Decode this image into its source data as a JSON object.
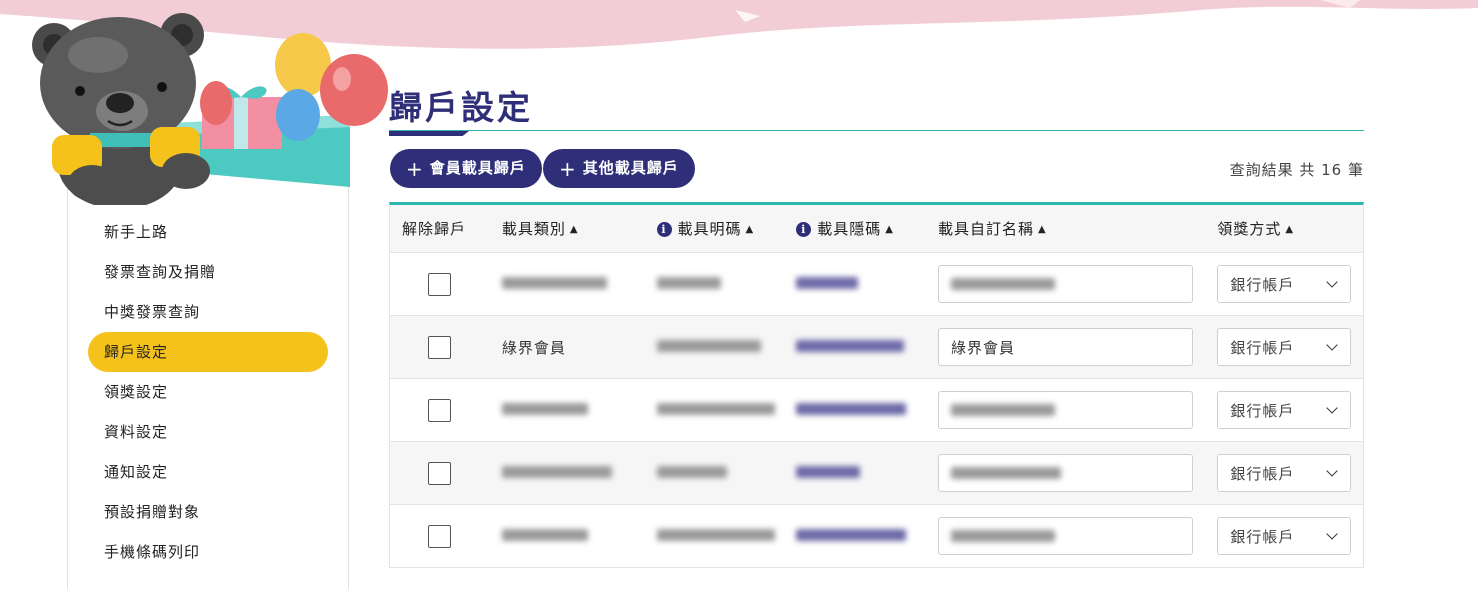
{
  "page_title": "歸戶設定",
  "sidebar": {
    "items": [
      {
        "label": "新手上路",
        "active": false
      },
      {
        "label": "發票查詢及捐贈",
        "active": false
      },
      {
        "label": "中獎發票查詢",
        "active": false
      },
      {
        "label": "歸戶設定",
        "active": true
      },
      {
        "label": "領獎設定",
        "active": false
      },
      {
        "label": "資料設定",
        "active": false
      },
      {
        "label": "通知設定",
        "active": false
      },
      {
        "label": "預設捐贈對象",
        "active": false
      },
      {
        "label": "手機條碼列印",
        "active": false
      }
    ]
  },
  "toolbar": {
    "member_carrier_button": "會員載具歸戶",
    "other_carrier_button": "其他載具歸戶",
    "result_text": "查詢結果 共 16 筆"
  },
  "table": {
    "headers": {
      "unlink": "解除歸戶",
      "carrier_type": "載具類別",
      "carrier_visible_code": "載具明碼",
      "carrier_hidden_code": "載具隱碼",
      "carrier_custom_name": "載具自訂名稱",
      "prize_method": "領獎方式"
    },
    "rows": [
      {
        "carrier_type": "",
        "custom_name": "",
        "prize_method": "銀行帳戶"
      },
      {
        "carrier_type": "綠界會員",
        "custom_name": "綠界會員",
        "prize_method": "銀行帳戶"
      },
      {
        "carrier_type": "",
        "custom_name": "",
        "prize_method": "銀行帳戶"
      },
      {
        "carrier_type": "",
        "custom_name": "",
        "prize_method": "銀行帳戶"
      },
      {
        "carrier_type": "",
        "custom_name": "",
        "prize_method": "銀行帳戶"
      }
    ]
  },
  "colors": {
    "navy": "#2e2f78",
    "teal": "#2bb6b0",
    "active_yellow": "#f5c21b",
    "banner_pink": "#f2cdd6"
  }
}
